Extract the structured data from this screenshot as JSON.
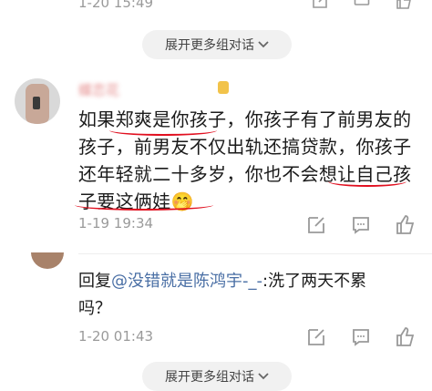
{
  "top_timestamp": "1-20 15:49",
  "expand_button_label": "展开更多组对话",
  "comment": {
    "username": "蝶恋花",
    "timestamp": "1-19 19:34",
    "text_lines": [
      "如果郑爽是你孩子，你孩子有了前男友的",
      "孩子，前男友不仅出轨还搞贷款，你孩子",
      "还年轻就二十多岁，你也不会想让自己孩",
      "子要这俩娃"
    ],
    "emoji": "🤭"
  },
  "reply": {
    "prefix": "回复",
    "mention": "@没错就是陈鸿宇-_-",
    "text_rest": ":洗了两天不累",
    "text_line2": "吗？",
    "timestamp": "1-20 01:43"
  },
  "expand_button_label_2": "展开更多组对话",
  "icons": [
    "edit-icon",
    "comment-icon",
    "like-icon"
  ]
}
